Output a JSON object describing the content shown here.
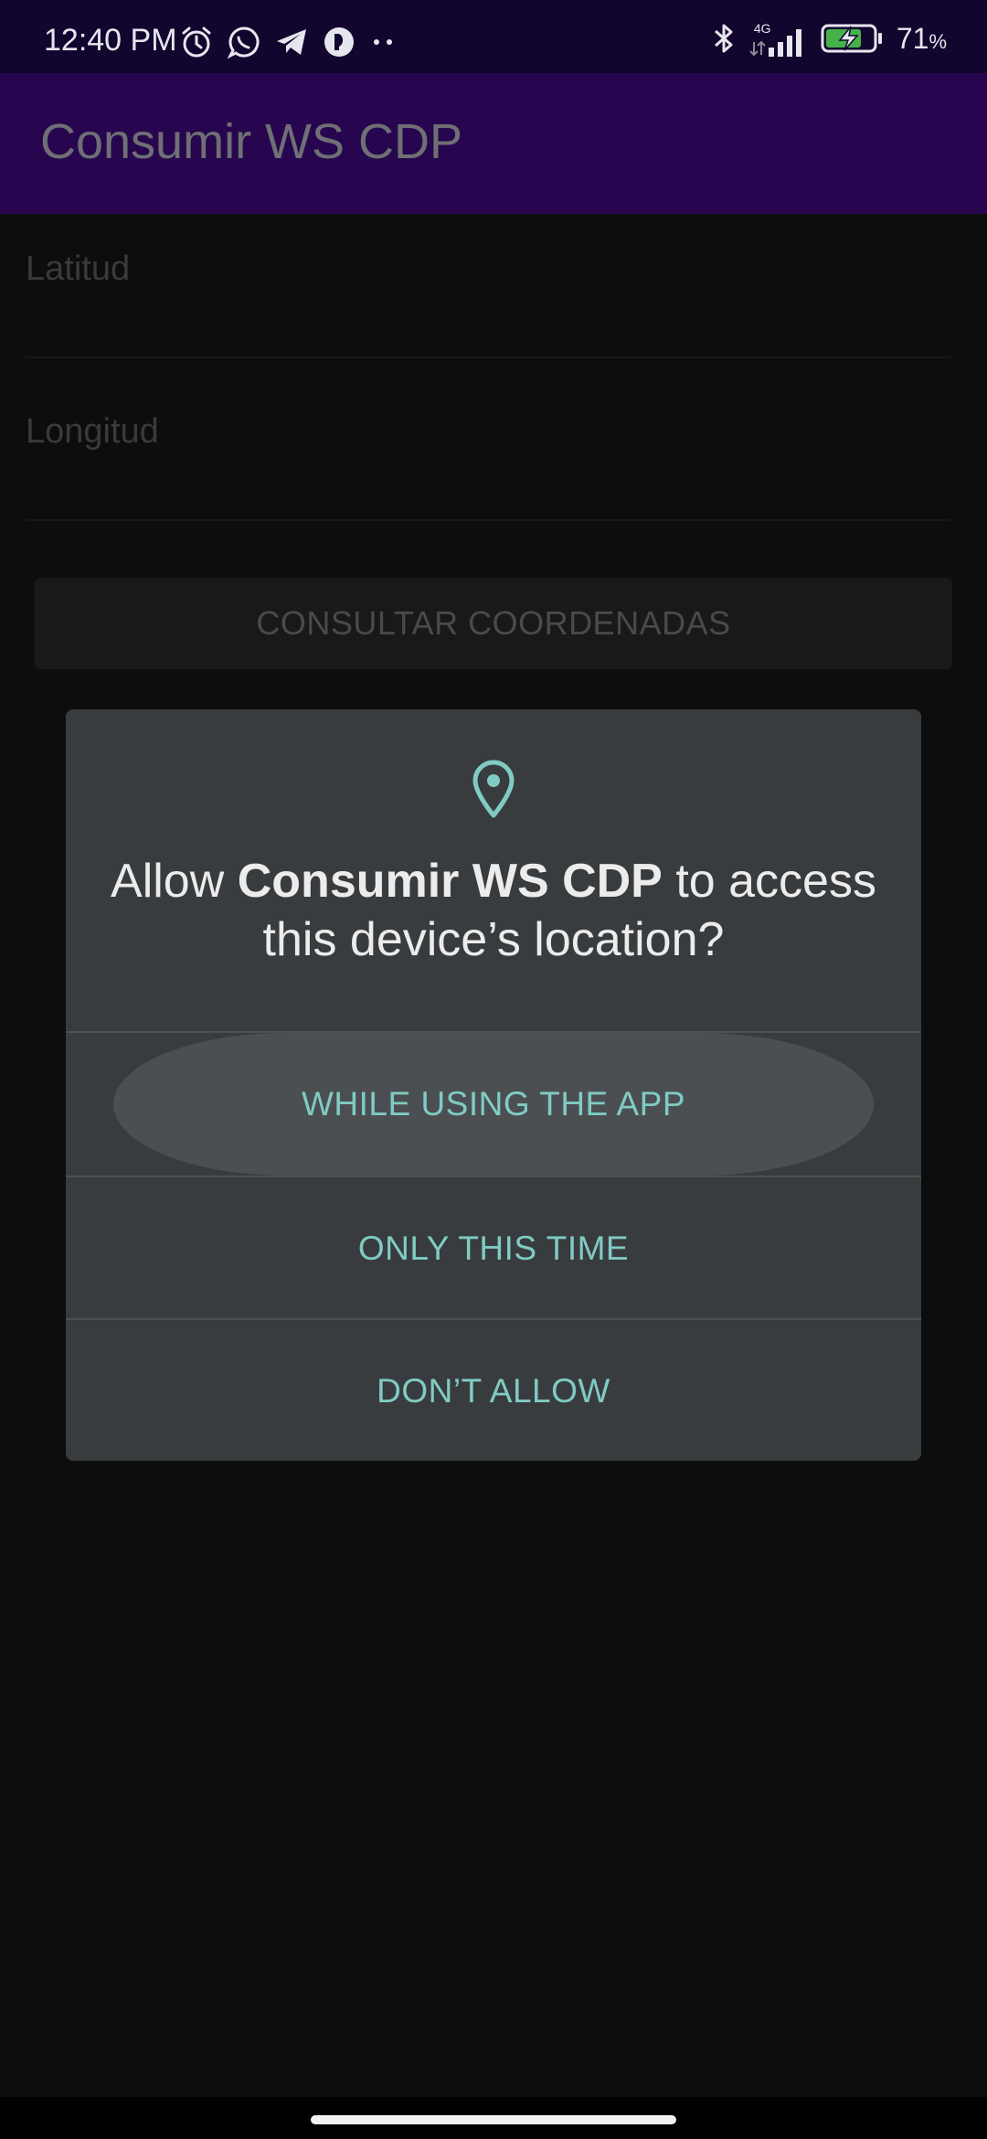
{
  "status_bar": {
    "time": "12:40 PM",
    "network_label": "4G",
    "battery_percent": "71",
    "battery_unit": "%",
    "icons_left": [
      "alarm-icon",
      "whatsapp-icon",
      "telegram-icon",
      "notification-app-icon",
      "more-notifications-icon"
    ],
    "icons_right": [
      "bluetooth-icon",
      "cellular-signal-icon",
      "battery-charging-icon"
    ]
  },
  "app_bar": {
    "title": "Consumir WS CDP",
    "color": "#27064f"
  },
  "form": {
    "latitude_hint": "Latitud",
    "longitude_hint": "Longitud",
    "consult_button_label": "CONSULTAR COORDENADAS"
  },
  "dialog": {
    "icon": "location-pin-icon",
    "title_prefix": "Allow ",
    "title_app_name": "Consumir WS CDP",
    "title_suffix": " to access this device’s location?",
    "options": [
      {
        "label": "WHILE USING THE APP",
        "pressed": true
      },
      {
        "label": "ONLY THIS TIME",
        "pressed": false
      },
      {
        "label": "DON’T ALLOW",
        "pressed": false
      }
    ],
    "accent_color": "#80cbc4"
  }
}
